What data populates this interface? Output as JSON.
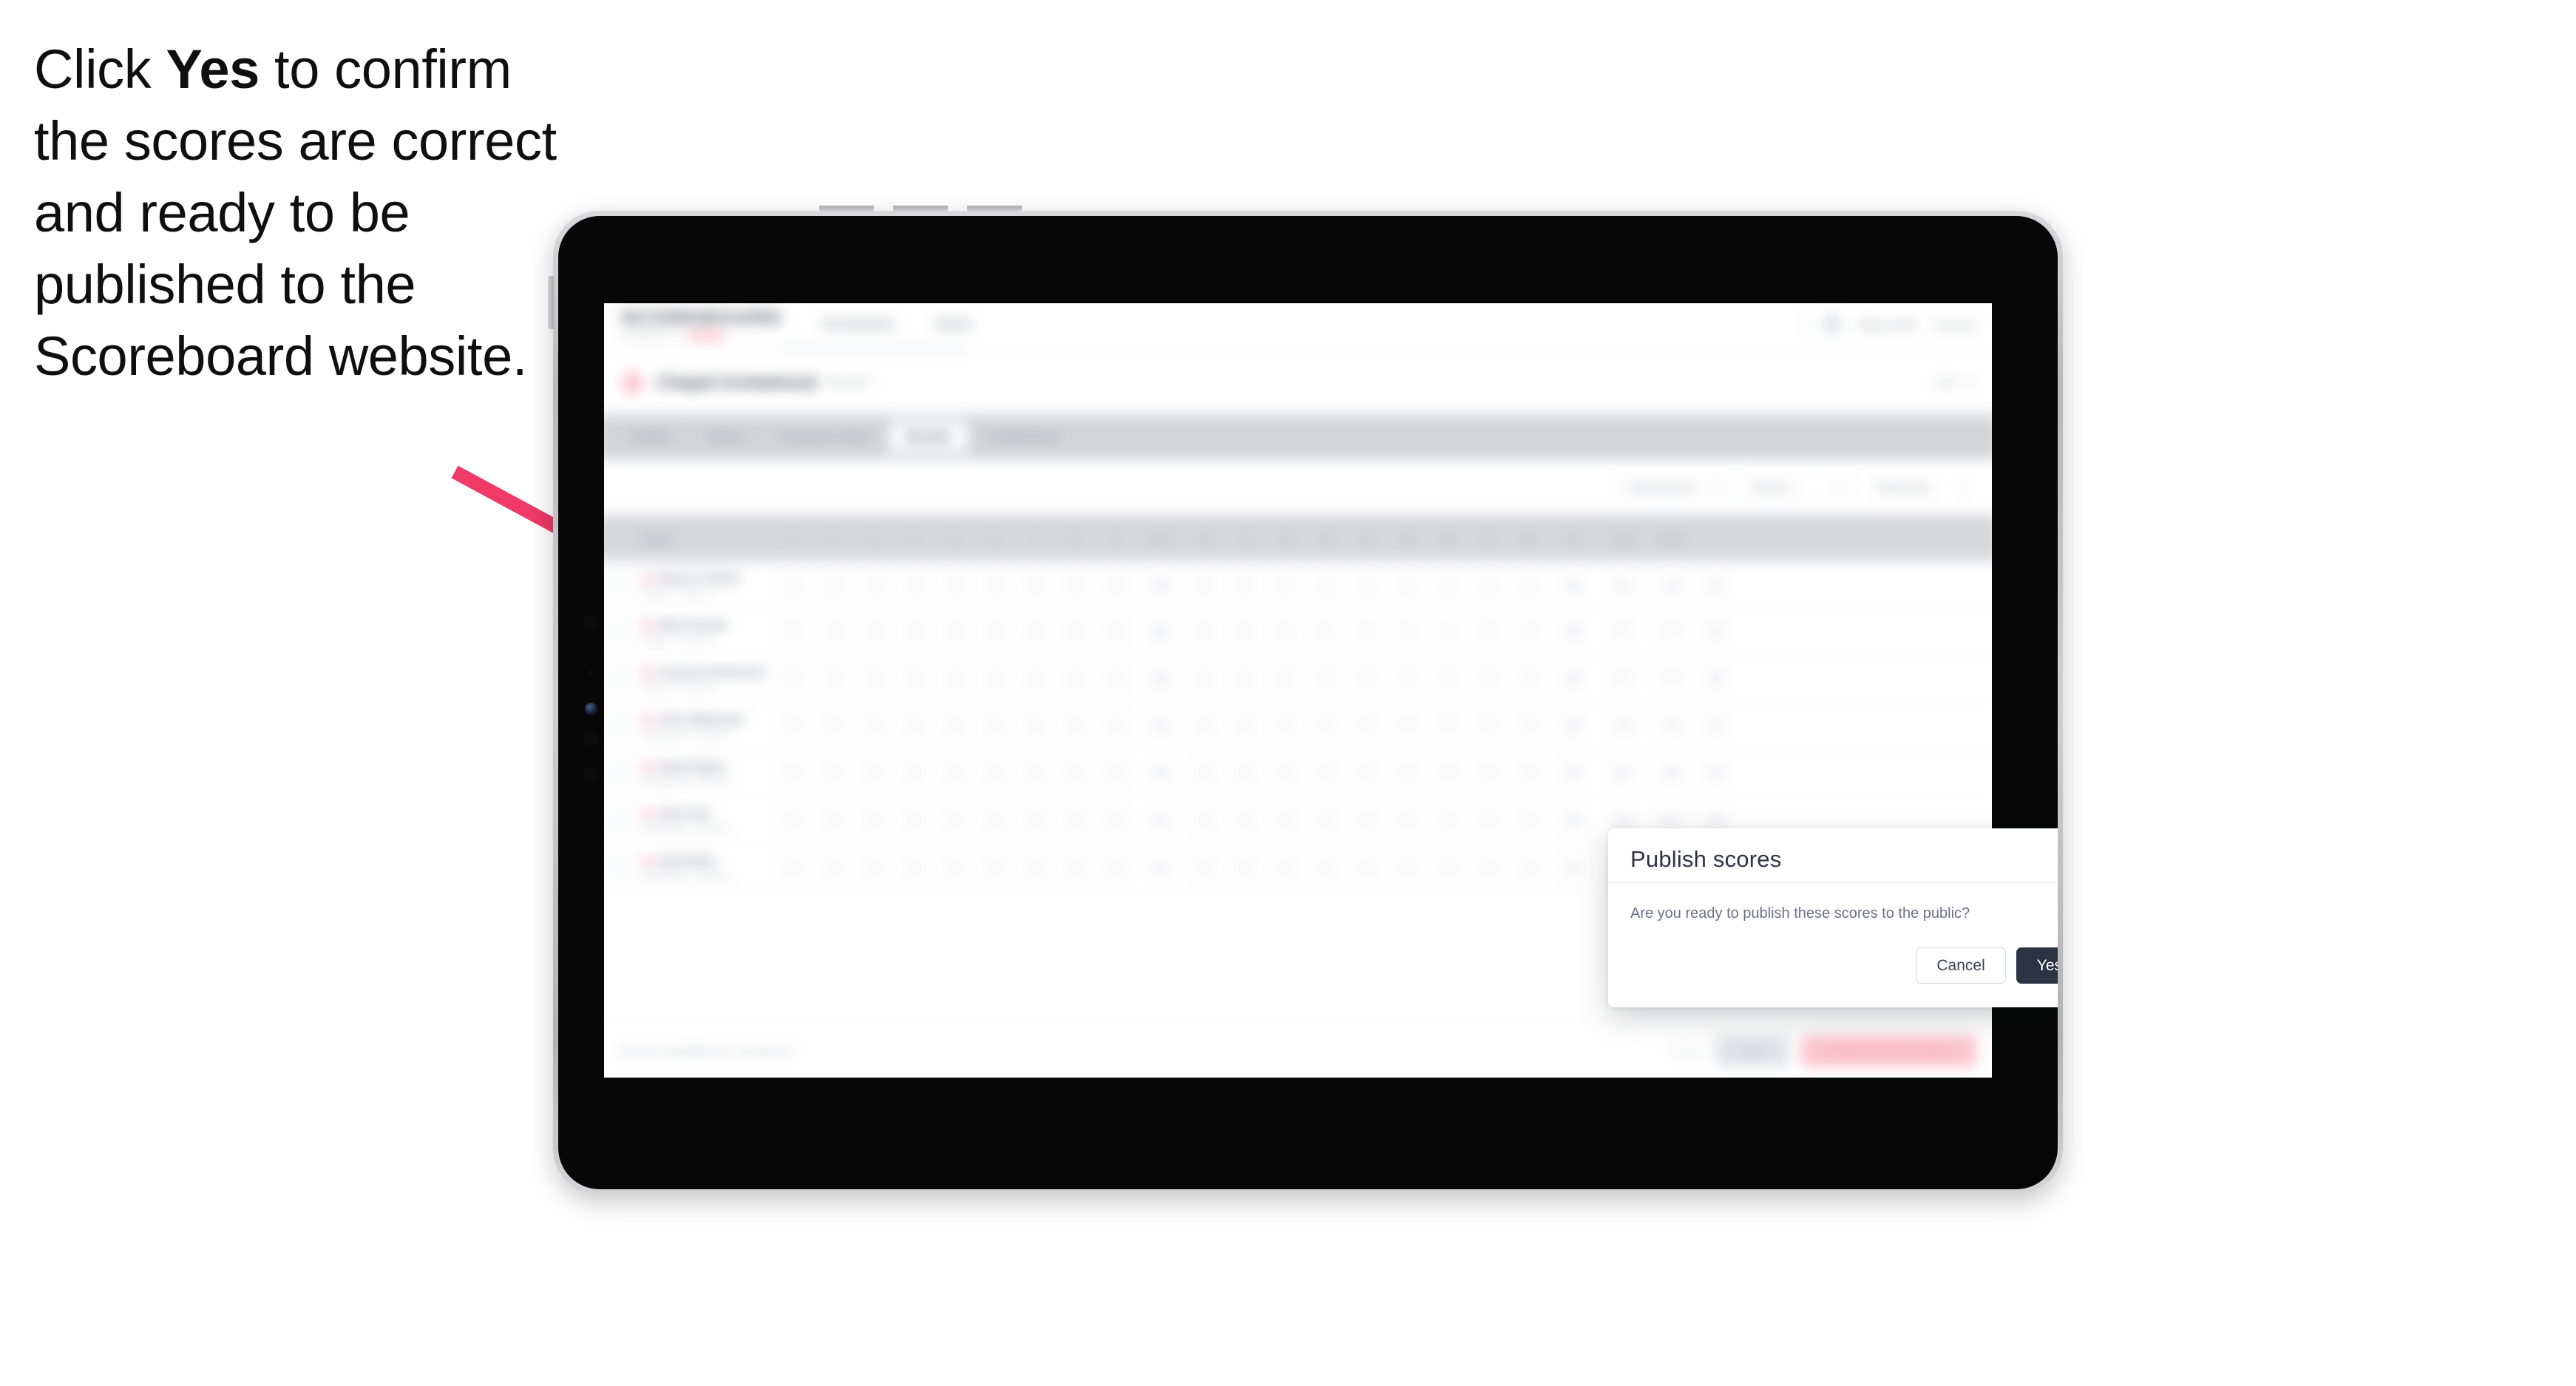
{
  "instruction": {
    "before_bold": "Click ",
    "bold": "Yes",
    "after_bold": " to confirm the scores are correct and ready to be published to the Scoreboard website."
  },
  "arrow": {
    "color": "#ef3a68"
  },
  "device": {
    "type": "tablet",
    "orientation": "landscape"
  },
  "app": {
    "brand": {
      "word": "SCOREBOARD",
      "sub": "POWERED BY"
    },
    "topnav": [
      {
        "label": "Tournaments"
      },
      {
        "label": "Teams"
      }
    ],
    "top_right": [
      {
        "label": "Help Centre"
      },
      {
        "label": "Account"
      }
    ],
    "title": {
      "main": "Chapel Invitational",
      "sub": "Round 1",
      "right": "Live"
    },
    "tabs": [
      {
        "label": "Details",
        "active": false
      },
      {
        "label": "Teams",
        "active": false
      },
      {
        "label": "Courses & Tees",
        "active": false
      },
      {
        "label": "Results",
        "active": true
      },
      {
        "label": "Leaderboard",
        "active": false
      }
    ],
    "filters": [
      {
        "label": "Filter by team",
        "type": "select"
      },
      {
        "label": "Round 1",
        "type": "select"
      },
      {
        "label": "Stroke play",
        "type": "plain"
      }
    ],
    "table": {
      "headers": [
        "Player",
        "1",
        "2",
        "3",
        "4",
        "5",
        "6",
        "7",
        "8",
        "9",
        "OUT",
        "10",
        "11",
        "12",
        "13",
        "14",
        "15",
        "16",
        "17",
        "18",
        "IN",
        "Total",
        "Points"
      ],
      "rows": [
        {
          "name": "Marcus Tomkin",
          "team": "Chapel – Group A",
          "scores": [
            "4",
            "5",
            "4",
            "3",
            "5",
            "4",
            "4",
            "4",
            "5",
            "38",
            "4",
            "5",
            "4",
            "4",
            "3",
            "5",
            "4",
            "4",
            "5",
            "38",
            "76",
            "76",
            "32"
          ]
        },
        {
          "name": "Elliot Parnell",
          "team": "Chapel – Group A",
          "scores": [
            "5",
            "4",
            "4",
            "4",
            "4",
            "5",
            "4",
            "3",
            "5",
            "38",
            "5",
            "4",
            "4",
            "5",
            "4",
            "4",
            "4",
            "5",
            "4",
            "39",
            "77",
            "77",
            "30"
          ]
        },
        {
          "name": "Cameron Robertson",
          "team": "Chapel – Group B",
          "scores": [
            "4",
            "4",
            "5",
            "4",
            "4",
            "4",
            "5",
            "4",
            "4",
            "38",
            "4",
            "4",
            "5",
            "4",
            "5",
            "4",
            "4",
            "4",
            "5",
            "39",
            "77",
            "77",
            "29"
          ]
        },
        {
          "name": "Chris Waterman",
          "team": "Southdown – Group A",
          "scores": [
            "5",
            "5",
            "4",
            "4",
            "5",
            "4",
            "4",
            "5",
            "4",
            "40",
            "5",
            "4",
            "4",
            "4",
            "5",
            "5",
            "4",
            "4",
            "4",
            "39",
            "79",
            "79",
            "27"
          ]
        },
        {
          "name": "Daniel Myers",
          "team": "Southdown – Group A",
          "scores": [
            "4",
            "5",
            "5",
            "4",
            "4",
            "5",
            "5",
            "4",
            "4",
            "40",
            "4",
            "5",
            "5",
            "4",
            "4",
            "4",
            "5",
            "4",
            "5",
            "40",
            "80",
            "80",
            "25"
          ]
        },
        {
          "name": "Sean Kirk",
          "team": "Southdown – Group B",
          "scores": [
            "5",
            "4",
            "4",
            "5",
            "5",
            "4",
            "4",
            "5",
            "5",
            "41",
            "4",
            "4",
            "5",
            "5",
            "4",
            "5",
            "4",
            "5",
            "4",
            "40",
            "81",
            "81",
            "22"
          ]
        },
        {
          "name": "Nick Baker",
          "team": "Southdown – Group B",
          "scores": [
            "5",
            "5",
            "5",
            "4",
            "4",
            "5",
            "4",
            "5",
            "4",
            "41",
            "5",
            "5",
            "4",
            "5",
            "4",
            "4",
            "5",
            "4",
            "5",
            "41",
            "82",
            "82",
            "20"
          ]
        }
      ]
    },
    "footer": {
      "note": "Results unpublished to scoreboard",
      "link": "Cancel",
      "secondary": "Save",
      "primary": "Publish scores to public"
    }
  },
  "modal": {
    "title": "Publish scores",
    "close_icon": "close-icon",
    "body": "Are you ready to publish these scores to the public?",
    "cancel_label": "Cancel",
    "yes_label": "Yes",
    "yes_color": "#2c3444"
  }
}
